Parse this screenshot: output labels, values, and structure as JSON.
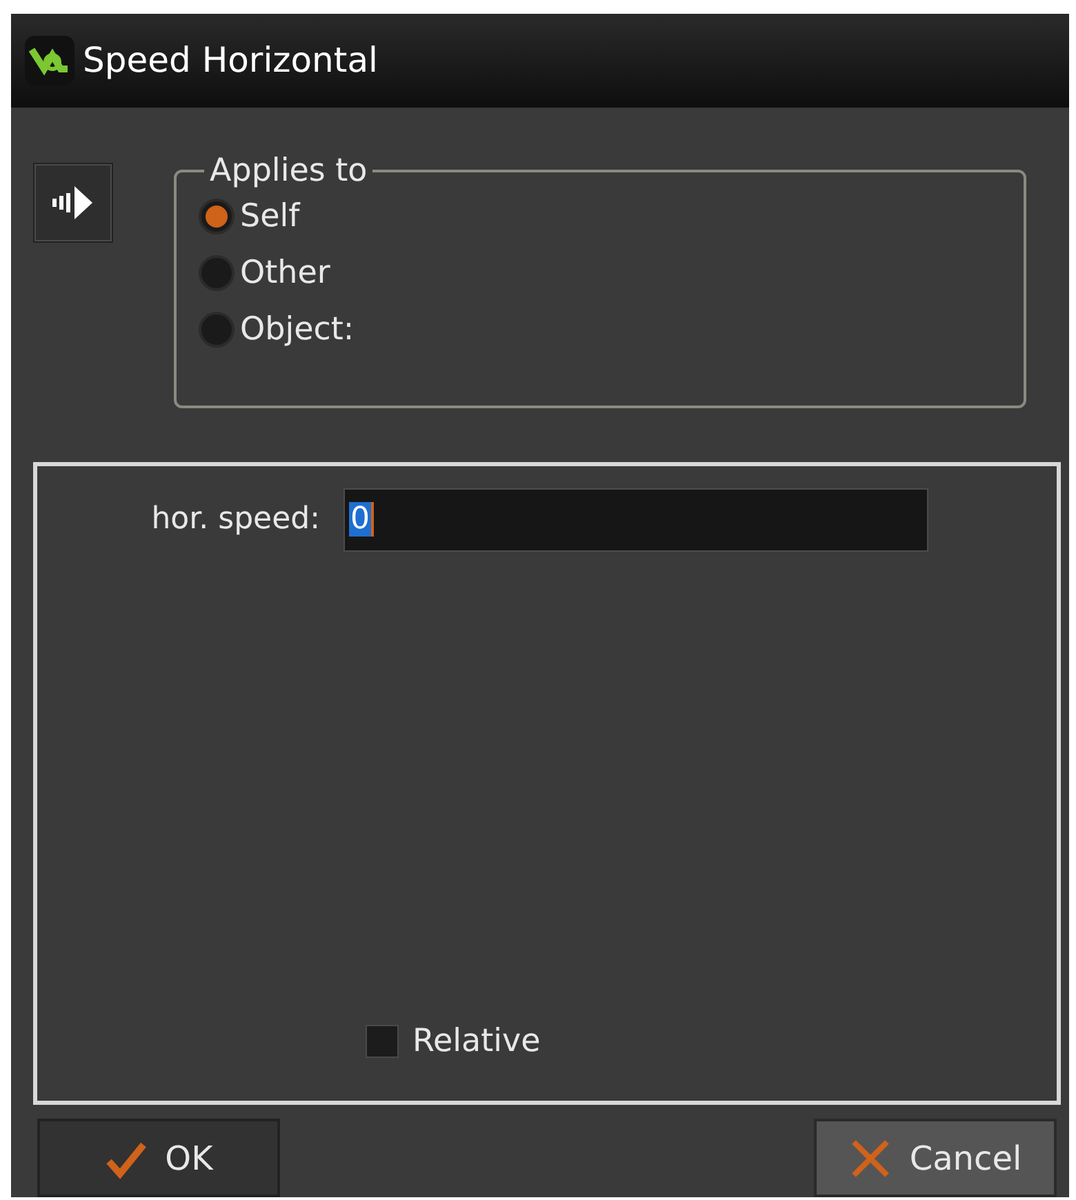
{
  "window": {
    "title": "Speed Horizontal"
  },
  "applies_to": {
    "label": "Applies to",
    "options": [
      {
        "label": "Self",
        "selected": true
      },
      {
        "label": "Other",
        "selected": false
      },
      {
        "label": "Object:",
        "selected": false
      }
    ]
  },
  "fields": [
    {
      "label": "hor. speed:",
      "value": "0"
    }
  ],
  "relative": {
    "label": "Relative",
    "checked": false
  },
  "buttons": [
    {
      "kind": "ok",
      "label": "OK"
    },
    {
      "kind": "cancel",
      "label": "Cancel"
    }
  ]
}
